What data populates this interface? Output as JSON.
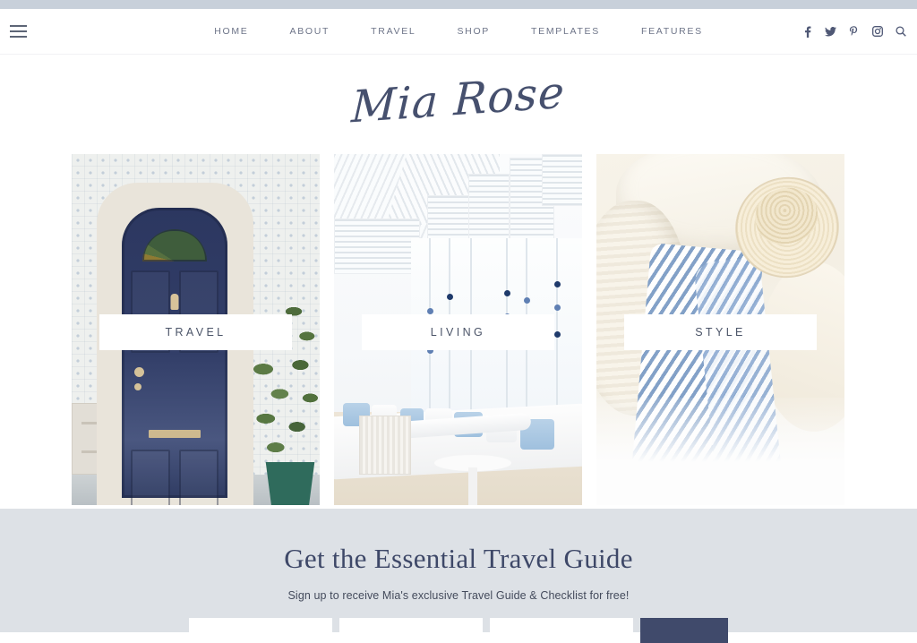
{
  "theme": {
    "top_band_color": "#c8d0da",
    "navy": "#404a6b",
    "nav_text_color": "#6d7488",
    "newsletter_bg": "#dde1e6",
    "label_text_color": "#4b5468"
  },
  "header": {
    "menu_icon": "hamburger-icon",
    "nav_items": [
      {
        "label": "HOME"
      },
      {
        "label": "ABOUT"
      },
      {
        "label": "TRAVEL"
      },
      {
        "label": "SHOP"
      },
      {
        "label": "TEMPLATES"
      },
      {
        "label": "FEATURES"
      }
    ],
    "social": [
      {
        "name": "facebook-icon"
      },
      {
        "name": "twitter-icon"
      },
      {
        "name": "pinterest-icon"
      },
      {
        "name": "instagram-icon"
      },
      {
        "name": "search-icon"
      }
    ]
  },
  "logo": {
    "text": "Mia Rose"
  },
  "cards": [
    {
      "label": "TRAVEL",
      "image_alt": "navy-blue-door-with-patterned-tiles"
    },
    {
      "label": "LIVING",
      "image_alt": "white-coastal-living-room-with-blue-cushions"
    },
    {
      "label": "STYLE",
      "image_alt": "straw-hat-with-blue-striped-fabric"
    }
  ],
  "newsletter": {
    "title": "Get the Essential Travel Guide",
    "subtitle": "Sign up to receive Mia's exclusive Travel Guide & Checklist for free!",
    "fields": [
      {
        "name": "first-name-field",
        "value": "",
        "placeholder": ""
      },
      {
        "name": "last-name-field",
        "value": "",
        "placeholder": ""
      },
      {
        "name": "email-field",
        "value": "",
        "placeholder": ""
      }
    ],
    "submit_label": ""
  }
}
